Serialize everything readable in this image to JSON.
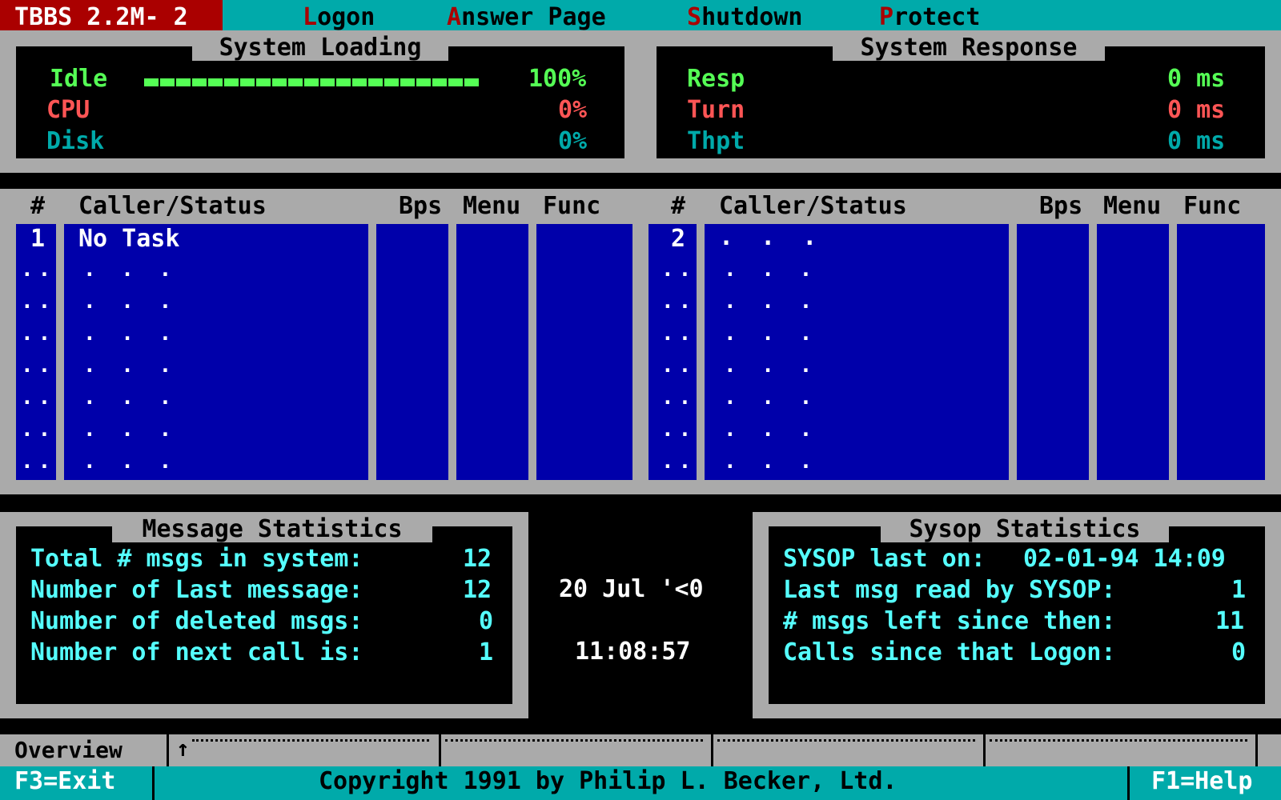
{
  "app": {
    "title": "TBBS 2.2M- 2"
  },
  "menu": [
    {
      "hotkey": "L",
      "rest": "ogon"
    },
    {
      "hotkey": "A",
      "rest": "nswer Page"
    },
    {
      "hotkey": "S",
      "rest": "hutdown"
    },
    {
      "hotkey": "P",
      "rest": "rotect"
    }
  ],
  "system_loading": {
    "title": "System Loading",
    "rows": [
      {
        "label": "Idle",
        "value": "100%",
        "fraction": 1.0
      },
      {
        "label": "CPU",
        "value": "0%",
        "fraction": 0.0
      },
      {
        "label": "Disk",
        "value": "0%",
        "fraction": 0.0
      }
    ]
  },
  "system_response": {
    "title": "System Response",
    "rows": [
      {
        "label": "Resp",
        "value": "0 ms"
      },
      {
        "label": "Turn",
        "value": "0 ms"
      },
      {
        "label": "Thpt",
        "value": "0 ms"
      }
    ]
  },
  "tasks": {
    "headers": {
      "num": "#",
      "caller": "Caller/Status",
      "bps": "Bps",
      "menu": "Menu",
      "func": "Func"
    },
    "left": {
      "number": "1",
      "status": "No Task"
    },
    "right": {
      "number": "2",
      "status": ". . ."
    },
    "placeholder_num": "..",
    "placeholder_status": ". . ."
  },
  "message_stats": {
    "title": "Message Statistics",
    "rows": [
      {
        "label": "Total # msgs in system:",
        "value": "12"
      },
      {
        "label": "Number of Last message:",
        "value": "12"
      },
      {
        "label": "Number of deleted msgs:",
        "value": "0"
      },
      {
        "label": "Number of next call is:",
        "value": "1"
      }
    ]
  },
  "clock": {
    "date": "20 Jul '<0",
    "time": "11:08:57"
  },
  "sysop_stats": {
    "title": "Sysop Statistics",
    "rows": [
      {
        "label": "SYSOP last on:",
        "value": "02-01-94 14:09"
      },
      {
        "label": "Last msg read by SYSOP:",
        "value": "1"
      },
      {
        "label": "# msgs left since then:",
        "value": "11"
      },
      {
        "label": "Calls since that Logon:",
        "value": "0"
      }
    ]
  },
  "tabs": {
    "active": "Overview",
    "marker": "↑"
  },
  "status_bar": {
    "left": "F3=Exit",
    "center": "Copyright 1991 by Philip L. Becker, Ltd.",
    "right": "F1=Help"
  }
}
